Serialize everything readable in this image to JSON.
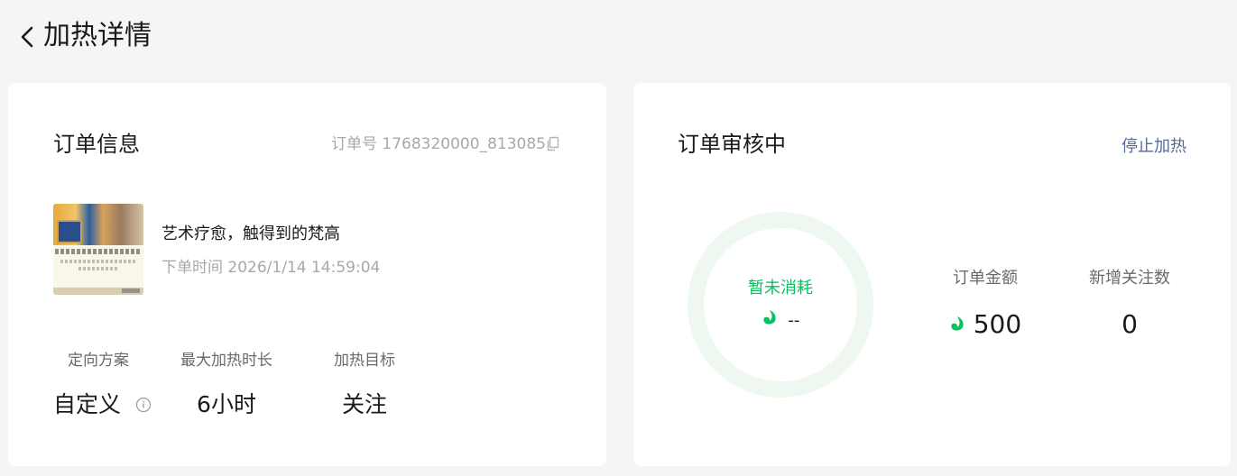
{
  "header": {
    "title": "加热详情"
  },
  "order_info": {
    "title": "订单信息",
    "order_number_label": "订单号 1768320000_813085",
    "product_name": "艺术疗愈，触得到的梵高",
    "order_time": "下单时间 2026/1/14 14:59:04",
    "stats": [
      {
        "label": "定向方案",
        "value": "自定义"
      },
      {
        "label": "最大加热时长",
        "value": "6小时"
      },
      {
        "label": "加热目标",
        "value": "关注"
      }
    ]
  },
  "review": {
    "title": "订单审核中",
    "stop_label": "停止加热",
    "ring_label": "暂未消耗",
    "ring_value": "--",
    "metrics": [
      {
        "label": "订单金额",
        "value": "500"
      },
      {
        "label": "新增关注数",
        "value": "0"
      }
    ]
  },
  "colors": {
    "accent_green": "#07c160",
    "link_blue": "#576b95",
    "ring_track": "#eef8f1"
  },
  "icons": [
    "chevron-left-icon",
    "copy-icon",
    "info-icon",
    "coin-icon"
  ]
}
